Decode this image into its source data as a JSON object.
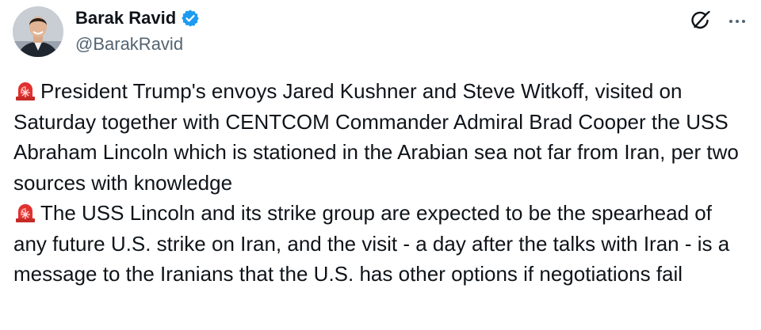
{
  "author": {
    "name": "Barak Ravid",
    "handle": "@BarakRavid",
    "verified": true
  },
  "icons": {
    "verified": "verified-badge-icon",
    "grok": "grok-icon",
    "more": "more-icon",
    "siren": "rotating-light-emoji"
  },
  "colors": {
    "text": "#0f1419",
    "secondary": "#536471",
    "verified_badge": "#1d9bf0",
    "siren": "#e0312f"
  },
  "tweet": {
    "paragraphs": [
      "President Trump's envoys Jared Kushner and Steve Witkoff, visited on Saturday together with CENTCOM Commander Admiral Brad Cooper the USS Abraham Lincoln which is stationed in the Arabian sea not far from Iran, per two sources with knowledge",
      "The USS Lincoln and its strike group are expected to be the spearhead of any future U.S. strike on Iran, and the visit - a day after the talks with Iran - is a message to the Iranians that the U.S. has other options if negotiations fail"
    ]
  }
}
